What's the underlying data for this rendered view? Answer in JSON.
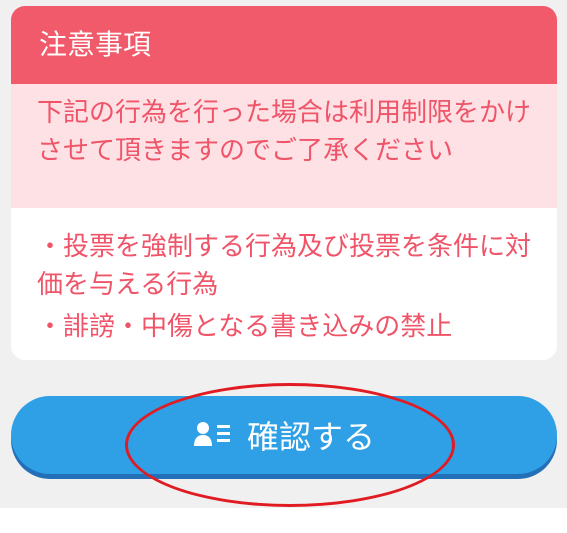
{
  "notice": {
    "title": "注意事項",
    "warning_text": "下記の行為を行った場合は利用制限をかけさせて頂きますのでご了承ください",
    "rules": [
      "・投票を強制する行為及び投票を条件に対価を与える行為",
      "・誹謗・中傷となる書き込みの禁止"
    ]
  },
  "confirm_button": {
    "label": "確認する",
    "icon": "user-list-icon"
  },
  "colors": {
    "header": "#f05a6a",
    "warning_bg": "#fde1e5",
    "text_red": "#ef5468",
    "button": "#2f9fe6",
    "annotation": "#e11b22"
  }
}
